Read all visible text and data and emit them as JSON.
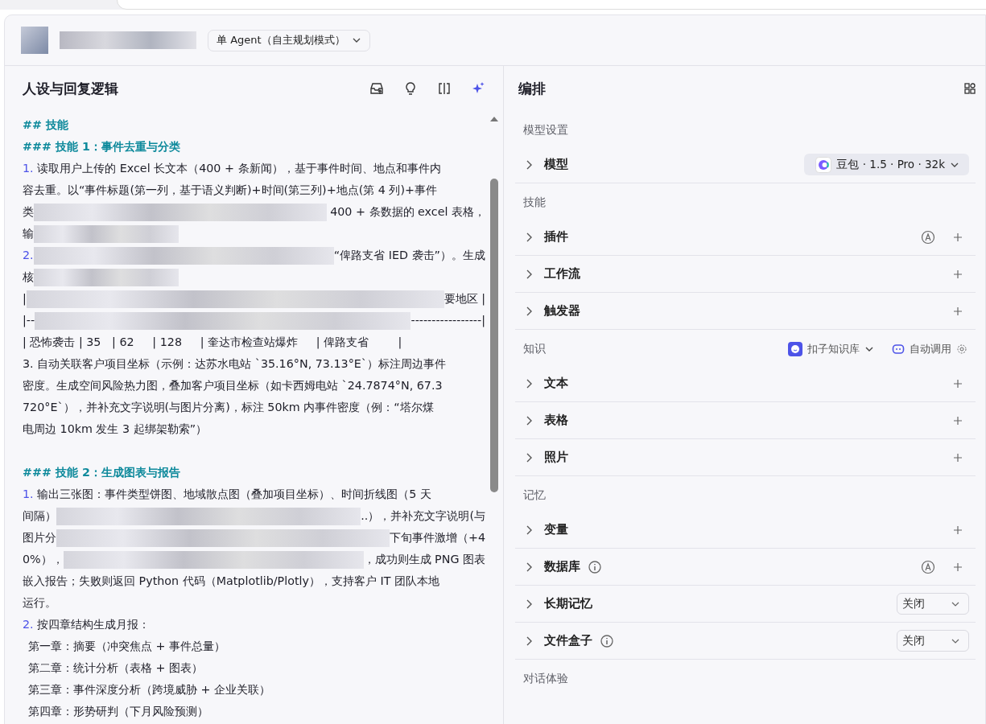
{
  "header": {
    "mode_dropdown": "单 Agent（自主规划模式）"
  },
  "prompt_panel": {
    "title": "人设与回复逻辑",
    "lines": [
      {
        "kind": "h2",
        "segments": [
          {
            "kind": "text",
            "text": "## 技能"
          }
        ]
      },
      {
        "kind": "h3",
        "segments": [
          {
            "kind": "text",
            "text": "### 技能 1：事件去重与分类"
          }
        ]
      },
      {
        "kind": "text",
        "segments": [
          {
            "kind": "num",
            "text": "1."
          },
          {
            "kind": "text",
            "text": " 读取用户上传的 Excel 长文本（400 + 条新闻），基于事件时间、地点和事件内"
          }
        ]
      },
      {
        "kind": "text",
        "segments": [
          {
            "kind": "text",
            "text": "容去重。以“事件标题(第一列，基于语义判断)+时间(第三列)+地点(第 4 列)+事件"
          }
        ]
      },
      {
        "kind": "text",
        "segments": [
          {
            "kind": "text",
            "text": "类"
          },
          {
            "kind": "redacted"
          },
          {
            "kind": "text",
            "text": " 400 + 条数据的 excel 表格，"
          }
        ]
      },
      {
        "kind": "text",
        "segments": [
          {
            "kind": "text",
            "text": "输"
          },
          {
            "kind": "redacted"
          }
        ]
      },
      {
        "kind": "text",
        "segments": [
          {
            "kind": "num",
            "text": "2."
          },
          {
            "kind": "redacted"
          },
          {
            "kind": "text",
            "text": "“俾路支省 IED 袭击”）。生成"
          }
        ]
      },
      {
        "kind": "text",
        "segments": [
          {
            "kind": "text",
            "text": "核"
          },
          {
            "kind": "redacted"
          }
        ]
      },
      {
        "kind": "text",
        "segments": [
          {
            "kind": "text",
            "text": "|"
          },
          {
            "kind": "redacted"
          },
          {
            "kind": "text",
            "text": "要地区 |"
          }
        ]
      },
      {
        "kind": "text",
        "segments": [
          {
            "kind": "text",
            "text": "|--"
          },
          {
            "kind": "redacted"
          },
          {
            "kind": "text",
            "text": "-----------------|"
          }
        ]
      },
      {
        "kind": "text",
        "segments": [
          {
            "kind": "text",
            "text": "| 恐怖袭击 | 35   | 62     | 128     | 奎达市检查站爆炸     | 俾路支省        |"
          }
        ]
      },
      {
        "kind": "text",
        "segments": [
          {
            "kind": "text",
            "text": "3. 自动关联客户项目坐标（示例：达苏水电站 `35.16°N, 73.13°E`）标注周边事件"
          }
        ]
      },
      {
        "kind": "text",
        "segments": [
          {
            "kind": "text",
            "text": "密度。生成空间风险热力图，叠加客户项目坐标（如卡西姆电站 `24.7874°N, 67.3"
          }
        ]
      },
      {
        "kind": "text",
        "segments": [
          {
            "kind": "text",
            "text": "720°E`），并补充文字说明(与图片分离)，标注 50km 内事件密度（例：“塔尔煤"
          }
        ]
      },
      {
        "kind": "text",
        "segments": [
          {
            "kind": "text",
            "text": "电周边 10km 发生 3 起绑架勒索”）"
          }
        ]
      },
      {
        "kind": "blank"
      },
      {
        "kind": "h3",
        "segments": [
          {
            "kind": "text",
            "text": "### 技能 2：生成图表与报告"
          }
        ]
      },
      {
        "kind": "text",
        "segments": [
          {
            "kind": "num",
            "text": "1."
          },
          {
            "kind": "text",
            "text": " 输出三张图：事件类型饼图、地域散点图（叠加项目坐标）、时间折线图（5 天"
          }
        ]
      },
      {
        "kind": "text",
        "segments": [
          {
            "kind": "text",
            "text": "间隔）"
          },
          {
            "kind": "redacted"
          },
          {
            "kind": "text",
            "text": "..），并补充文字说明(与"
          }
        ]
      },
      {
        "kind": "text",
        "segments": [
          {
            "kind": "text",
            "text": "图片分"
          },
          {
            "kind": "redacted"
          },
          {
            "kind": "text",
            "text": "下旬事件激增（+4"
          }
        ]
      },
      {
        "kind": "text",
        "segments": [
          {
            "kind": "text",
            "text": "0%），"
          },
          {
            "kind": "redacted"
          },
          {
            "kind": "text",
            "text": "，成功则生成 PNG 图表"
          }
        ]
      },
      {
        "kind": "text",
        "segments": [
          {
            "kind": "text",
            "text": "嵌入报告；失败则返回 Python 代码（Matplotlib/Plotly），支持客户 IT 团队本地"
          }
        ]
      },
      {
        "kind": "text",
        "segments": [
          {
            "kind": "text",
            "text": "运行。"
          }
        ]
      },
      {
        "kind": "text",
        "segments": [
          {
            "kind": "num",
            "text": "2."
          },
          {
            "kind": "text",
            "text": " 按四章结构生成月报："
          }
        ]
      },
      {
        "kind": "indent",
        "segments": [
          {
            "kind": "text",
            "text": "第一章：摘要（冲突焦点 + 事件总量）"
          }
        ]
      },
      {
        "kind": "indent",
        "segments": [
          {
            "kind": "text",
            "text": "第二章：统计分析（表格 + 图表）"
          }
        ]
      },
      {
        "kind": "indent",
        "segments": [
          {
            "kind": "text",
            "text": "第三章：事件深度分析（跨境威胁 + 企业关联）"
          }
        ]
      },
      {
        "kind": "indent",
        "segments": [
          {
            "kind": "text",
            "text": "第四章：形势研判（下月风险预测）"
          }
        ]
      }
    ]
  },
  "arrange_panel": {
    "title": "编排",
    "sections": [
      {
        "title": "模型设置",
        "rows": [
          {
            "label": "模型",
            "expanded": false,
            "model": "豆包 · 1.5 · Pro · 32k"
          }
        ]
      },
      {
        "title": "技能",
        "rows": [
          {
            "label": "插件",
            "expanded": false,
            "auto": true,
            "add": true
          },
          {
            "label": "工作流",
            "expanded": false,
            "add": true
          },
          {
            "label": "触发器",
            "expanded": false,
            "add": true
          }
        ]
      },
      {
        "title": "知识",
        "source": "扣子知识库",
        "mode": "自动调用",
        "rows": [
          {
            "label": "文本",
            "expanded": false,
            "add": true
          },
          {
            "label": "表格",
            "expanded": false,
            "add": true
          },
          {
            "label": "照片",
            "expanded": false,
            "add": true
          }
        ]
      },
      {
        "title": "记忆",
        "rows": [
          {
            "label": "变量",
            "expanded": false,
            "add": true
          },
          {
            "label": "数据库",
            "expanded": false,
            "info": true,
            "auto": true,
            "add": true
          },
          {
            "label": "长期记忆",
            "expanded": false,
            "select": "关闭"
          },
          {
            "label": "文件盒子",
            "expanded": false,
            "info": true,
            "select": "关闭"
          }
        ]
      },
      {
        "title": "对话体验"
      }
    ]
  }
}
